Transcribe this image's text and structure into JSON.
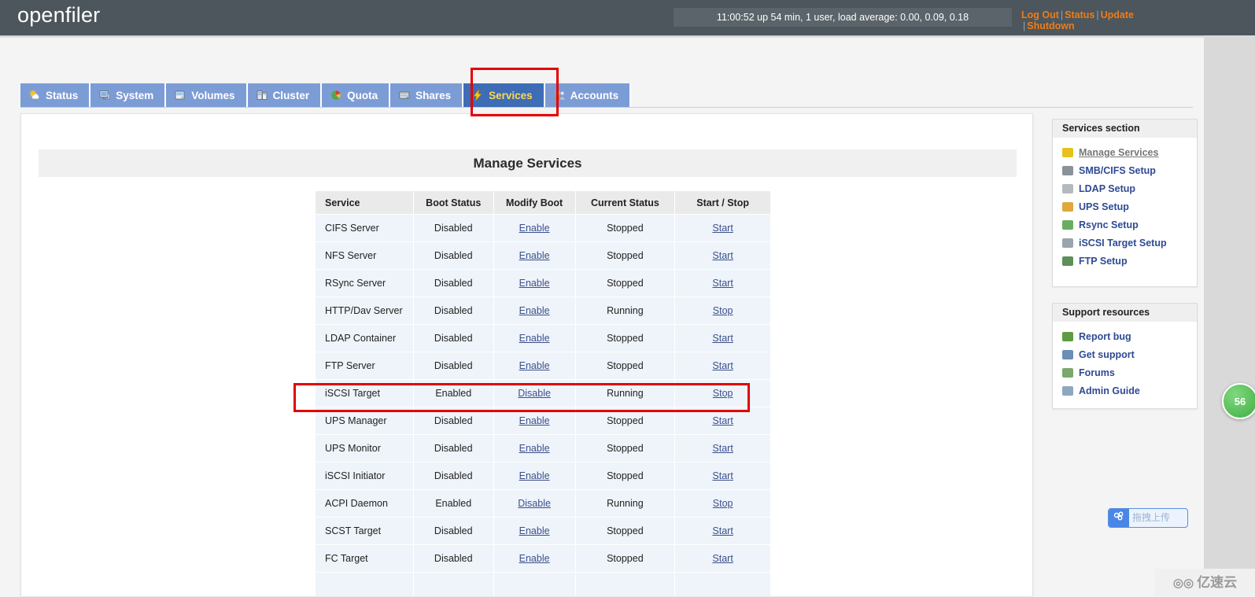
{
  "header": {
    "logo": "openfiler",
    "uptime": "11:00:52 up 54 min, 1 user, load average: 0.00, 0.09, 0.18",
    "links": [
      {
        "label": "Log Out"
      },
      {
        "label": "Status"
      },
      {
        "label": "Update"
      },
      {
        "label": "Shutdown"
      }
    ],
    "separator": "|"
  },
  "nav": {
    "tabs": [
      {
        "label": "Status",
        "icon": "sun-cloud-icon",
        "active": false
      },
      {
        "label": "System",
        "icon": "monitor-icon",
        "active": false
      },
      {
        "label": "Volumes",
        "icon": "disk-stack-icon",
        "active": false
      },
      {
        "label": "Cluster",
        "icon": "servers-icon",
        "active": false
      },
      {
        "label": "Quota",
        "icon": "pie-chart-icon",
        "active": false
      },
      {
        "label": "Shares",
        "icon": "drive-icon",
        "active": false
      },
      {
        "label": "Services",
        "icon": "lightning-icon",
        "active": true
      },
      {
        "label": "Accounts",
        "icon": "people-icon",
        "active": false
      }
    ]
  },
  "main": {
    "page_title": "Manage Services",
    "table": {
      "columns": [
        "Service",
        "Boot Status",
        "Modify Boot",
        "Current Status",
        "Start / Stop"
      ],
      "rows": [
        {
          "service": "CIFS Server",
          "boot": "Disabled",
          "modify": "Enable",
          "current": "Stopped",
          "action": "Start"
        },
        {
          "service": "NFS Server",
          "boot": "Disabled",
          "modify": "Enable",
          "current": "Stopped",
          "action": "Start"
        },
        {
          "service": "RSync Server",
          "boot": "Disabled",
          "modify": "Enable",
          "current": "Stopped",
          "action": "Start"
        },
        {
          "service": "HTTP/Dav Server",
          "boot": "Disabled",
          "modify": "Enable",
          "current": "Running",
          "action": "Stop"
        },
        {
          "service": "LDAP Container",
          "boot": "Disabled",
          "modify": "Enable",
          "current": "Stopped",
          "action": "Start"
        },
        {
          "service": "FTP Server",
          "boot": "Disabled",
          "modify": "Enable",
          "current": "Stopped",
          "action": "Start"
        },
        {
          "service": "iSCSI Target",
          "boot": "Enabled",
          "modify": "Disable",
          "current": "Running",
          "action": "Stop"
        },
        {
          "service": "UPS Manager",
          "boot": "Disabled",
          "modify": "Enable",
          "current": "Stopped",
          "action": "Start"
        },
        {
          "service": "UPS Monitor",
          "boot": "Disabled",
          "modify": "Enable",
          "current": "Stopped",
          "action": "Start"
        },
        {
          "service": "iSCSI Initiator",
          "boot": "Disabled",
          "modify": "Enable",
          "current": "Stopped",
          "action": "Start"
        },
        {
          "service": "ACPI Daemon",
          "boot": "Enabled",
          "modify": "Disable",
          "current": "Running",
          "action": "Stop"
        },
        {
          "service": "SCST Target",
          "boot": "Disabled",
          "modify": "Enable",
          "current": "Stopped",
          "action": "Start"
        },
        {
          "service": "FC Target",
          "boot": "Disabled",
          "modify": "Enable",
          "current": "Stopped",
          "action": "Start"
        },
        {
          "service": "",
          "boot": "",
          "modify": "",
          "current": "",
          "action": ""
        }
      ]
    }
  },
  "sidebar": {
    "services_section": {
      "title": "Services section",
      "items": [
        {
          "label": "Manage Services",
          "icon": "gears-icon",
          "current": true,
          "color": "#e8c21c"
        },
        {
          "label": "SMB/CIFS Setup",
          "icon": "server-icon",
          "current": false,
          "color": "#8a9199"
        },
        {
          "label": "LDAP Setup",
          "icon": "ldap-icon",
          "current": false,
          "color": "#b4b9bd"
        },
        {
          "label": "UPS Setup",
          "icon": "ups-icon",
          "current": false,
          "color": "#e0a83c"
        },
        {
          "label": "Rsync Setup",
          "icon": "rsync-icon",
          "current": false,
          "color": "#6aad62"
        },
        {
          "label": "iSCSI Target Setup",
          "icon": "iscsi-icon",
          "current": false,
          "color": "#9aa5ad"
        },
        {
          "label": "FTP Setup",
          "icon": "ftp-icon",
          "current": false,
          "color": "#5d8f58"
        }
      ]
    },
    "support_section": {
      "title": "Support resources",
      "items": [
        {
          "label": "Report bug",
          "icon": "bug-icon",
          "color": "#5f9a44"
        },
        {
          "label": "Get support",
          "icon": "envelope-icon",
          "color": "#6b8fb5"
        },
        {
          "label": "Forums",
          "icon": "forum-icon",
          "color": "#7aa86d"
        },
        {
          "label": "Admin Guide",
          "icon": "book-icon",
          "color": "#8fa6c0"
        }
      ]
    }
  },
  "widgets": {
    "green_badge": "56",
    "upload": {
      "icon": "cloud-upload-icon",
      "label": "拖拽上传"
    },
    "watermark": {
      "mark": "◎◎",
      "label": "亿速云"
    }
  }
}
